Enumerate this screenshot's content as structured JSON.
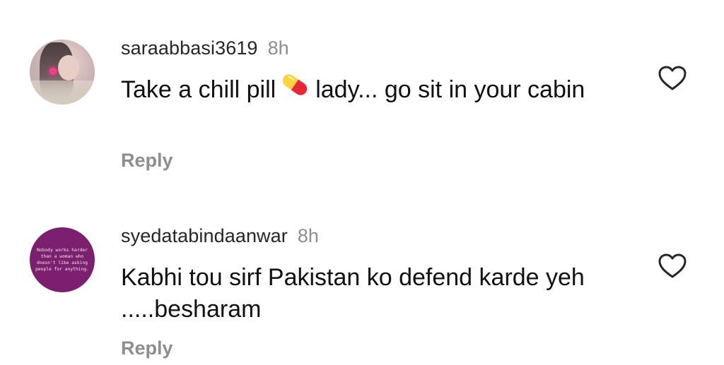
{
  "comments": [
    {
      "username": "saraabbasi3619",
      "time": "8h",
      "text_before": "Take a chill pill",
      "emoji": "pill",
      "text_after": "lady... go sit in your cabin",
      "reply_label": "Reply",
      "like_icon": "heart-outline-icon",
      "avatar": "profile-photo"
    },
    {
      "username": "syedatabindaanwar",
      "time": "8h",
      "text": "Kabhi tou sirf Pakistan ko defend karde yeh .....besharam",
      "reply_label": "Reply",
      "like_icon": "heart-outline-icon",
      "avatar": "quote-image",
      "avatar_text": "Nobody works harder than a woman who doesn't like asking people for anything."
    }
  ],
  "colors": {
    "primary_text": "#262626",
    "secondary_text": "#8e8e8e",
    "avatar_quote_bg": "#7b1f6e"
  }
}
